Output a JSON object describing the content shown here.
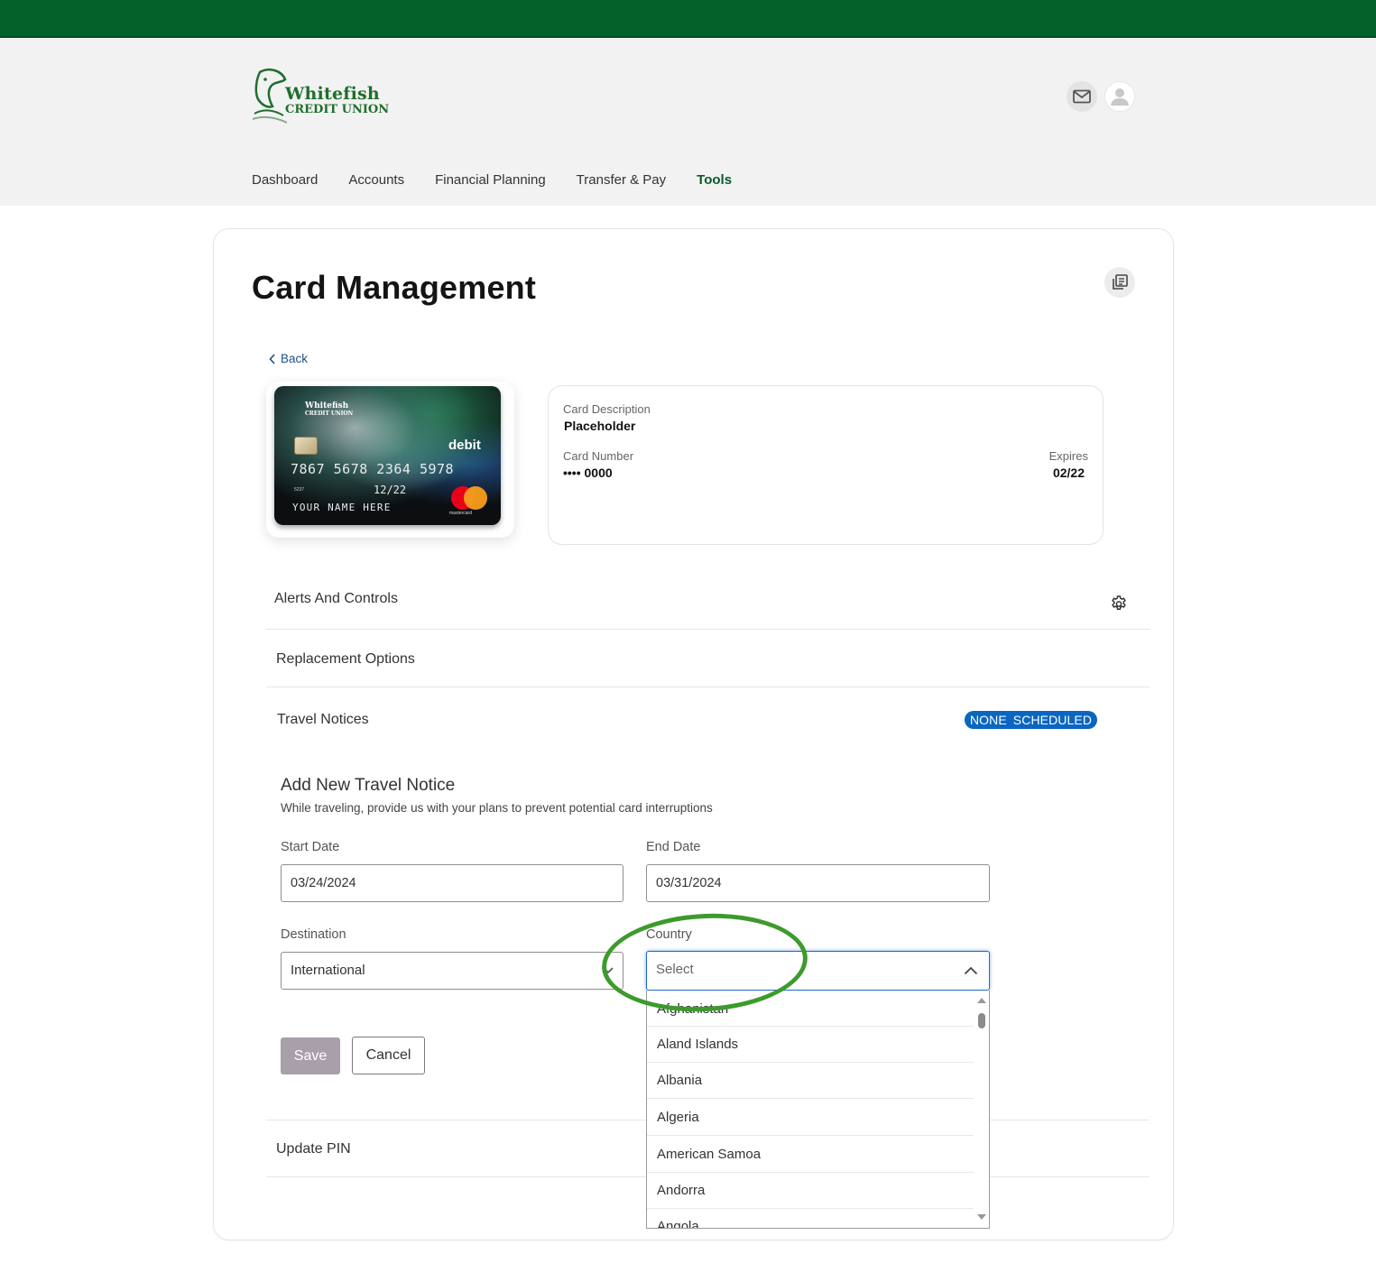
{
  "brand": {
    "name_line1": "Whitefish",
    "name_line2": "CREDIT UNION",
    "primary_color": "#02622a",
    "accent_color": "#0b5a2a"
  },
  "header": {
    "mail_icon": "mail-icon",
    "user_icon": "user-avatar-icon"
  },
  "nav": {
    "items": [
      {
        "label": "Dashboard",
        "active": false
      },
      {
        "label": "Accounts",
        "active": false
      },
      {
        "label": "Financial Planning",
        "active": false
      },
      {
        "label": "Transfer & Pay",
        "active": false
      },
      {
        "label": "Tools",
        "active": true
      }
    ]
  },
  "page": {
    "title": "Card Management",
    "print_icon": "print-icon",
    "back_label": "Back"
  },
  "card_image": {
    "bank_line1": "Whitefish",
    "bank_line2": "CREDIT UNION",
    "type_label": "debit",
    "number": "7867 5678 2364 5978",
    "sub_number": "5237",
    "valid_thru": "12/22",
    "holder": "YOUR NAME HERE",
    "network": "mastercard"
  },
  "card_info": {
    "description_label": "Card Description",
    "description_value": "Placeholder",
    "number_label": "Card Number",
    "number_value": "•••• 0000",
    "expires_label": "Expires",
    "expires_value": "02/22"
  },
  "sections": {
    "alerts": "Alerts And Controls",
    "replacement": "Replacement Options",
    "travel": "Travel Notices",
    "travel_badge": "NONE SCHEDULED",
    "pin": "Update PIN"
  },
  "travel_form": {
    "title": "Add New Travel Notice",
    "subtitle": "While traveling, provide us with your plans to prevent potential card interruptions",
    "start_label": "Start Date",
    "start_value": "03/24/2024",
    "end_label": "End Date",
    "end_value": "03/31/2024",
    "destination_label": "Destination",
    "destination_value": "International",
    "country_label": "Country",
    "country_placeholder": "Select",
    "country_options": [
      "Afghanistan",
      "Aland Islands",
      "Albania",
      "Algeria",
      "American Samoa",
      "Andorra",
      "Angola"
    ],
    "save_label": "Save",
    "cancel_label": "Cancel"
  }
}
